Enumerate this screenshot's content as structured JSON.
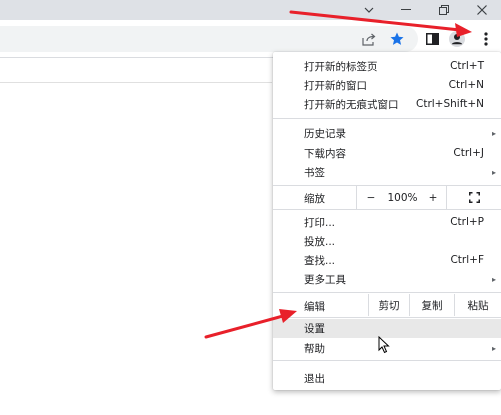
{
  "window_controls": {
    "dropdown_icon": "chevron-down-icon",
    "minimize_icon": "minimize-icon",
    "restore_icon": "restore-icon",
    "close_icon": "close-icon"
  },
  "toolbar": {
    "share_icon": "share-icon",
    "bookmark_icon": "star-icon",
    "bookmark_color": "#1a73e8",
    "sidepanel_icon": "side-panel-icon",
    "profile_icon": "profile-icon",
    "menu_icon": "kebab-menu-icon"
  },
  "menu": {
    "new_tab": {
      "label": "打开新的标签页",
      "shortcut": "Ctrl+T"
    },
    "new_window": {
      "label": "打开新的窗口",
      "shortcut": "Ctrl+N"
    },
    "new_incognito": {
      "label": "打开新的无痕式窗口",
      "shortcut": "Ctrl+Shift+N"
    },
    "history": {
      "label": "历史记录",
      "arrow": "▸"
    },
    "downloads": {
      "label": "下载内容",
      "shortcut": "Ctrl+J"
    },
    "bookmarks": {
      "label": "书签",
      "arrow": "▸"
    },
    "zoom": {
      "label": "缩放",
      "minus": "−",
      "value": "100%",
      "plus": "+",
      "fullscreen_icon": "fullscreen-icon"
    },
    "print": {
      "label": "打印...",
      "shortcut": "Ctrl+P"
    },
    "cast": {
      "label": "投放..."
    },
    "find": {
      "label": "查找...",
      "shortcut": "Ctrl+F"
    },
    "more_tools": {
      "label": "更多工具",
      "arrow": "▸"
    },
    "edit": {
      "label": "编辑",
      "cut": "剪切",
      "copy": "复制",
      "paste": "粘贴"
    },
    "settings": {
      "label": "设置"
    },
    "help": {
      "label": "帮助",
      "arrow": "▸"
    },
    "exit": {
      "label": "退出"
    }
  },
  "annotations": {
    "arrow_color": "#e8202a"
  }
}
